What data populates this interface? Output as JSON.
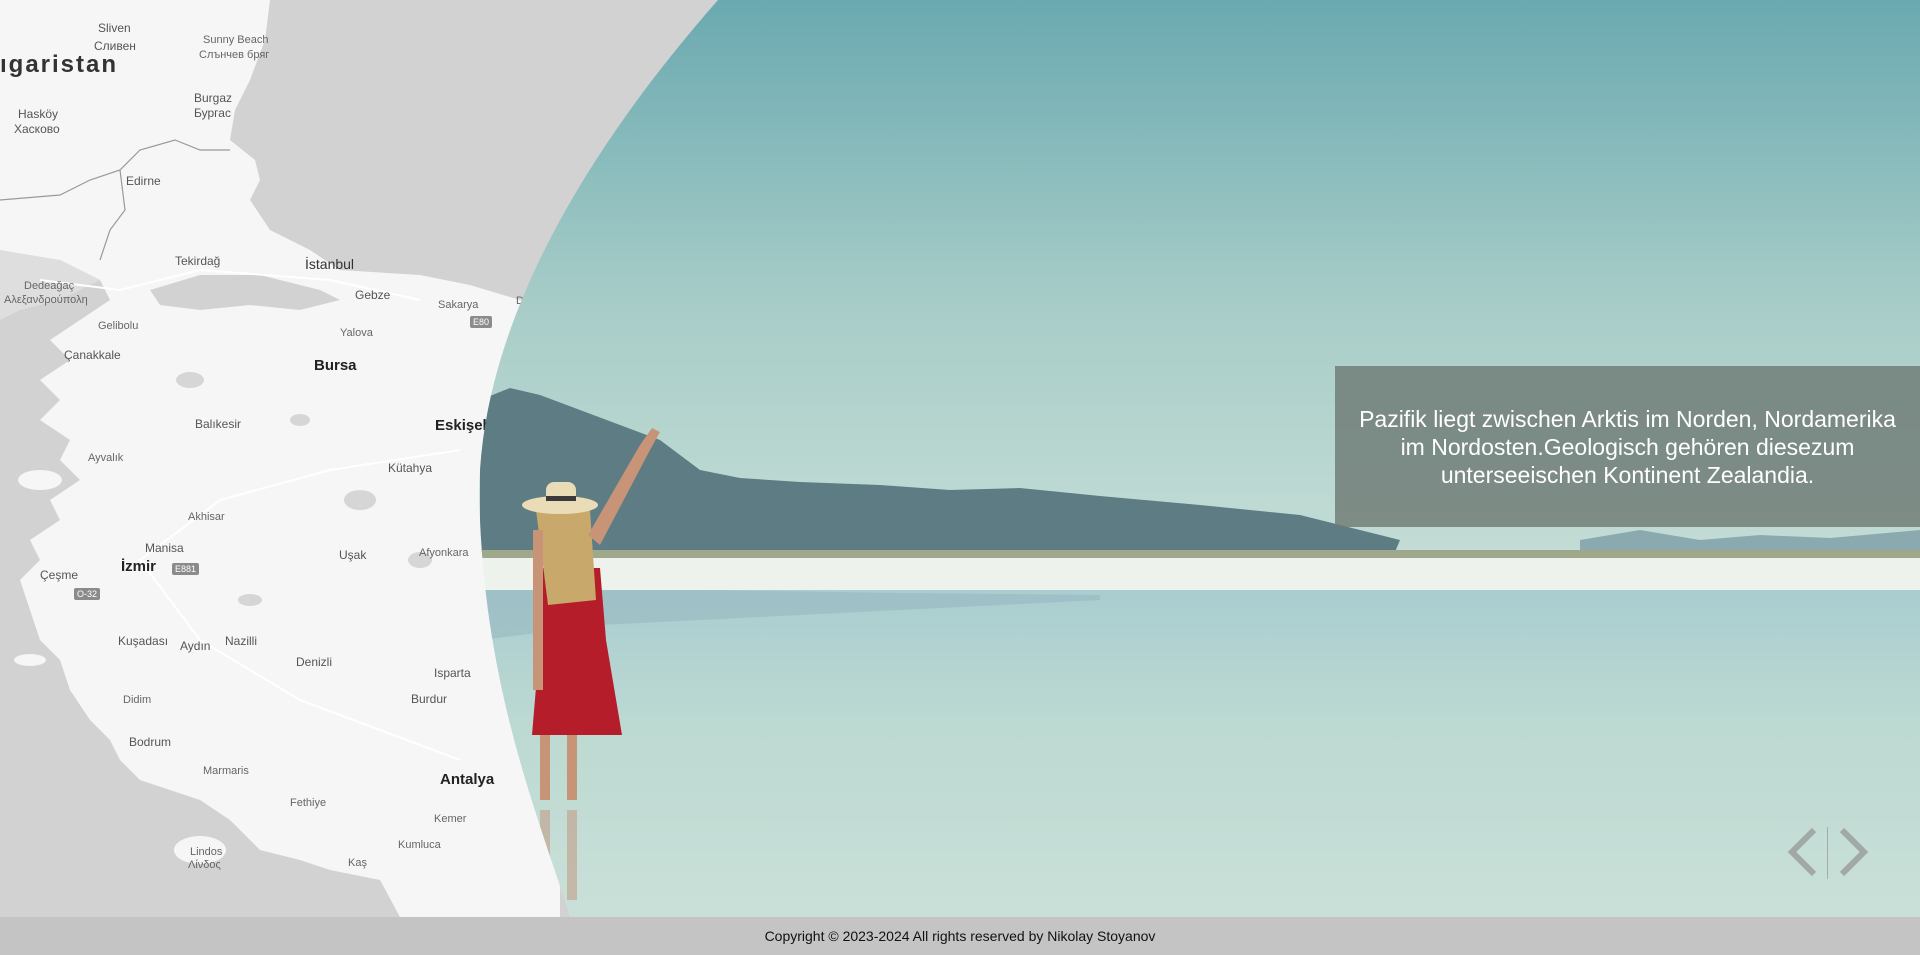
{
  "map": {
    "country_fragment": "ıgaristan",
    "labels": {
      "sliven": "Sliven",
      "sliven_cyr": "Сливен",
      "sunny_beach": "Sunny Beach",
      "sunny_beach_cyr": "Слънчев бряг",
      "burgaz": "Burgaz",
      "burgaz_cyr": "Бургас",
      "haskoy": "Hasköy",
      "haskoy_cyr": "Хасково",
      "edirne": "Edirne",
      "tekirdag": "Tekirdağ",
      "istanbul": "İstanbul",
      "gebze": "Gebze",
      "sakarya": "Sakarya",
      "dedeagac": "Dedeağaç",
      "dedeagac_gr": "Αλεξανδρούπολη",
      "gelibolu": "Gelibolu",
      "yalova": "Yalova",
      "canakkale": "Çanakkale",
      "bursa": "Bursa",
      "balikesir": "Balıkesir",
      "eskisehir": "Eskişeh",
      "ayvalik": "Ayvalık",
      "kutahya": "Kütahya",
      "akhisar": "Akhisar",
      "manisa": "Manisa",
      "izmir": "İzmir",
      "usak": "Uşak",
      "afyonkara": "Afyonkara",
      "cesme": "Çeşme",
      "kusadasi": "Kuşadası",
      "aydin": "Aydın",
      "nazilli": "Nazilli",
      "denizli": "Denizli",
      "isparta": "Isparta",
      "burdur": "Burdur",
      "didim": "Didim",
      "bodrum": "Bodrum",
      "marmaris": "Marmaris",
      "antalya": "Antalya",
      "fethiye": "Fethiye",
      "kemer": "Kemer",
      "kumluca": "Kumluca",
      "lindos": "Lindos",
      "lindos_gr": "Λίνδος",
      "kas": "Kaş",
      "d_frag": "D"
    },
    "shields": {
      "e80": "E80",
      "e881": "E881",
      "o32": "O-32"
    }
  },
  "caption": {
    "text": "Pazifik liegt zwischen Arktis im Norden, Nordamerika im Nordosten.Geologisch gehören diesezum unterseeischen Kontinent Zealandia."
  },
  "nav": {
    "prev_icon": "chevron-left-icon",
    "next_icon": "chevron-right-icon"
  },
  "footer": {
    "copyright": "Copyright © 2023-2024 All rights reserved by Nikolay Stoyanov"
  }
}
